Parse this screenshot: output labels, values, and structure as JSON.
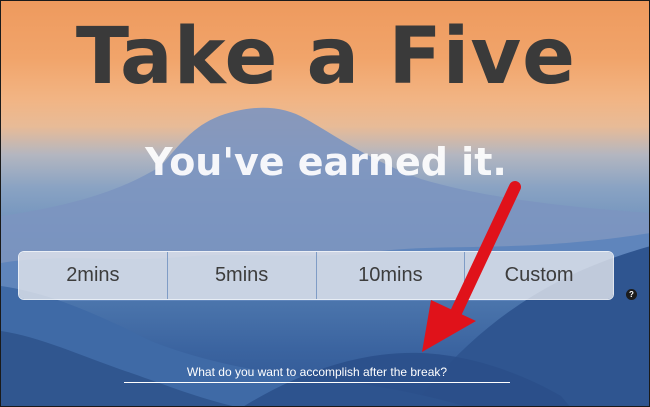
{
  "page": {
    "title": "Take a Five",
    "subtitle": "You've earned it."
  },
  "durations": {
    "options": [
      "2mins",
      "5mins",
      "10mins",
      "Custom"
    ]
  },
  "help": {
    "label": "?"
  },
  "goal": {
    "placeholder": "What do you want to accomplish after the break?",
    "value": ""
  },
  "annotation": {
    "arrow_color": "#e0121a"
  },
  "colors": {
    "title": "#3a3a3a",
    "subtitle": "#ffffff",
    "option_text": "#3d3d3d"
  }
}
